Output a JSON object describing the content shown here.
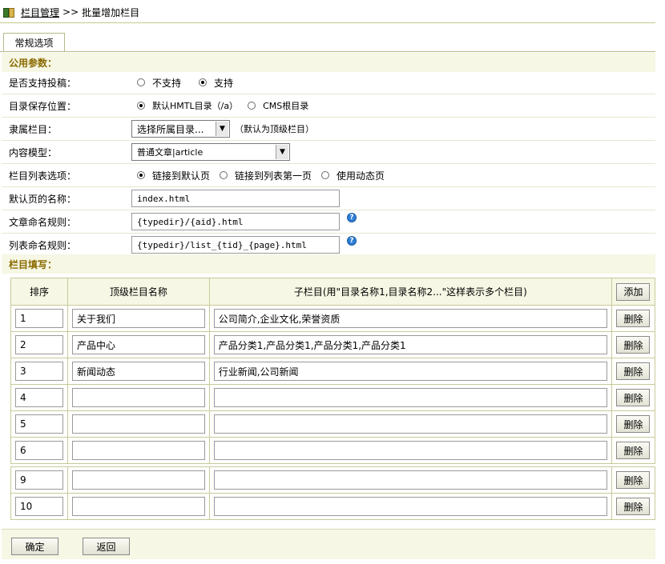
{
  "breadcrumb": {
    "root": "栏目管理",
    "separator": ">>",
    "current": "批量增加栏目"
  },
  "tabs": [
    {
      "label": "常规选项"
    }
  ],
  "common_section": {
    "title": "公用参数："
  },
  "fields": {
    "allow_submit": {
      "label": "是否支持投稿：",
      "options": [
        "不支持",
        "支持"
      ],
      "selected": "支持"
    },
    "save_location": {
      "label": "目录保存位置：",
      "options": [
        "默认HMTL目录（/a）",
        "CMS根目录"
      ],
      "selected": "默认HMTL目录（/a）"
    },
    "parent": {
      "label": "隶属栏目：",
      "value": "选择所属目录...",
      "note": "（默认为顶级栏目）"
    },
    "model": {
      "label": "内容模型：",
      "value": "普通文章|article"
    },
    "list_option": {
      "label": "栏目列表选项：",
      "options": [
        "链接到默认页",
        "链接到列表第一页",
        "使用动态页"
      ],
      "selected": "链接到默认页"
    },
    "default_page": {
      "label": "默认页的名称：",
      "value": "index.html"
    },
    "article_rule": {
      "label": "文章命名规则：",
      "value": "{typedir}/{aid}.html"
    },
    "list_rule": {
      "label": "列表命名规则：",
      "value": "{typedir}/list_{tid}_{page}.html"
    }
  },
  "fill_section": {
    "title": "栏目填写："
  },
  "grid": {
    "headers": {
      "order": "排序",
      "name": "顶级栏目名称",
      "children": "子栏目(用\"目录名称1,目录名称2...\"这样表示多个栏目)",
      "add": "添加"
    },
    "delete_label": "删除",
    "rows": [
      {
        "order": "1",
        "name": "关于我们",
        "children": "公司简介,企业文化,荣誉资质"
      },
      {
        "order": "2",
        "name": "产品中心",
        "children": "产品分类1,产品分类1,产品分类1,产品分类1"
      },
      {
        "order": "3",
        "name": "新闻动态",
        "children": "行业新闻,公司新闻"
      },
      {
        "order": "4",
        "name": "",
        "children": ""
      },
      {
        "order": "5",
        "name": "",
        "children": ""
      },
      {
        "order": "6",
        "name": "",
        "children": ""
      },
      {
        "order": "9",
        "name": "",
        "children": ""
      },
      {
        "order": "10",
        "name": "",
        "children": ""
      }
    ]
  },
  "footer": {
    "confirm": "确定",
    "back": "返回"
  }
}
